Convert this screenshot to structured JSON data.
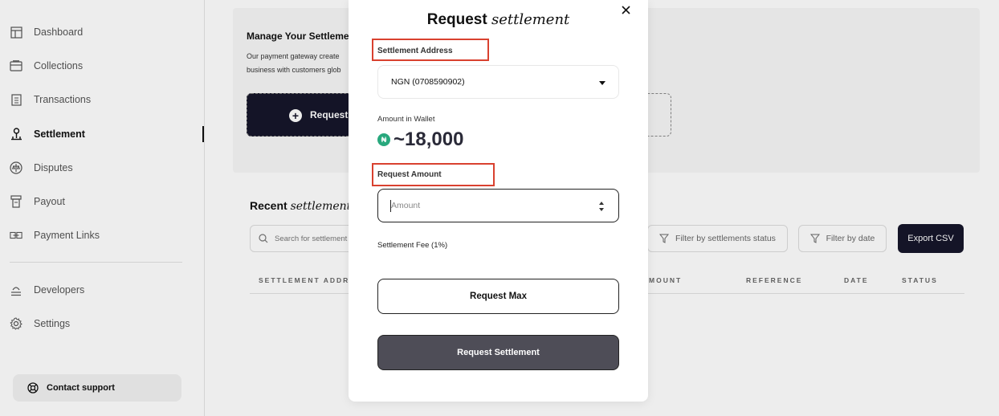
{
  "sidebar": {
    "items": [
      {
        "label": "Dashboard",
        "icon": "dashboard-icon"
      },
      {
        "label": "Collections",
        "icon": "collections-icon"
      },
      {
        "label": "Transactions",
        "icon": "transactions-icon"
      },
      {
        "label": "Settlement",
        "icon": "settlement-icon",
        "active": true
      },
      {
        "label": "Disputes",
        "icon": "disputes-icon"
      },
      {
        "label": "Payout",
        "icon": "payout-icon"
      },
      {
        "label": "Payment Links",
        "icon": "payment-links-icon"
      },
      {
        "label": "Developers",
        "icon": "developers-icon"
      },
      {
        "label": "Settings",
        "icon": "settings-icon"
      }
    ],
    "support_label": "Contact support"
  },
  "main": {
    "manage_title": "Manage Your Settlemen",
    "manage_desc_line1": "Our payment gateway create",
    "manage_desc_line2": "business with customers glob",
    "request_button_label": "Request",
    "recent_title_plain": "Recent ",
    "recent_title_italic": "settlements",
    "search_placeholder": "Search for settlement",
    "filter_status_label": "Filter by settlements status",
    "filter_date_label": "Filter by date",
    "export_label": "Export CSV",
    "table_headers": [
      "SETTLEMENT ADDRE",
      "MOUNT",
      "REFERENCE",
      "DATE",
      "STATUS"
    ]
  },
  "modal": {
    "title_plain": "Request ",
    "title_italic": "settlement",
    "settlement_address_label": "Settlement Address",
    "selected_address": "NGN (0708590902)",
    "wallet_label": "Amount in Wallet",
    "wallet_currency_symbol": "₦",
    "wallet_amount": "~18,000",
    "request_amount_label": "Request Amount",
    "amount_placeholder": "Amount",
    "fee_label": "Settlement Fee (1%)",
    "request_max_label": "Request Max",
    "request_settlement_label": "Request Settlement"
  },
  "colors": {
    "dark_accent": "#16162a",
    "highlight": "#d9412f",
    "wallet_badge": "#28a87d",
    "primary_button": "#4e4d57"
  }
}
